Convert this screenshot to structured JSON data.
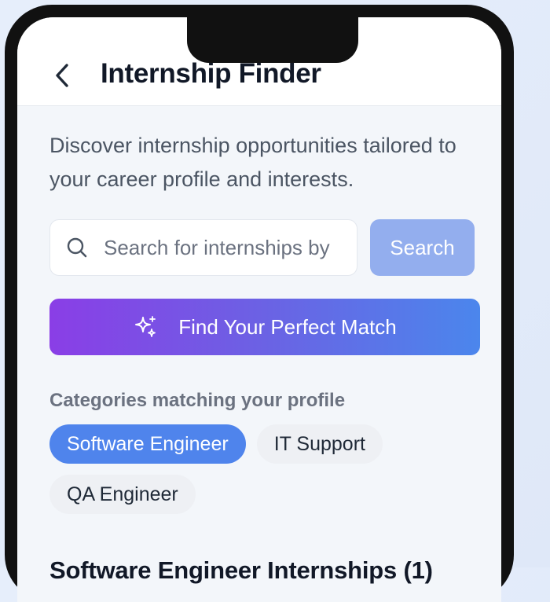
{
  "header": {
    "title": "Internship Finder",
    "back_icon": "chevron-left-icon"
  },
  "intro": {
    "description": "Discover internship opportunities tailored to your career profile and interests."
  },
  "search": {
    "placeholder": "Search for internships by",
    "value": "",
    "button_label": "Search",
    "icon": "search-icon"
  },
  "match_button": {
    "label": "Find Your Perfect Match",
    "icon": "sparkle-icon"
  },
  "categories": {
    "title": "Categories matching your profile",
    "items": [
      {
        "label": "Software Engineer",
        "selected": true
      },
      {
        "label": "IT Support",
        "selected": false
      },
      {
        "label": "QA Engineer",
        "selected": false
      }
    ]
  },
  "results": {
    "title": "Software Engineer Internships (1)"
  },
  "colors": {
    "accent": "#4f84ec",
    "search_button": "#93aeee",
    "gradient_start": "#8a3ee6",
    "gradient_end": "#4b86ec"
  }
}
